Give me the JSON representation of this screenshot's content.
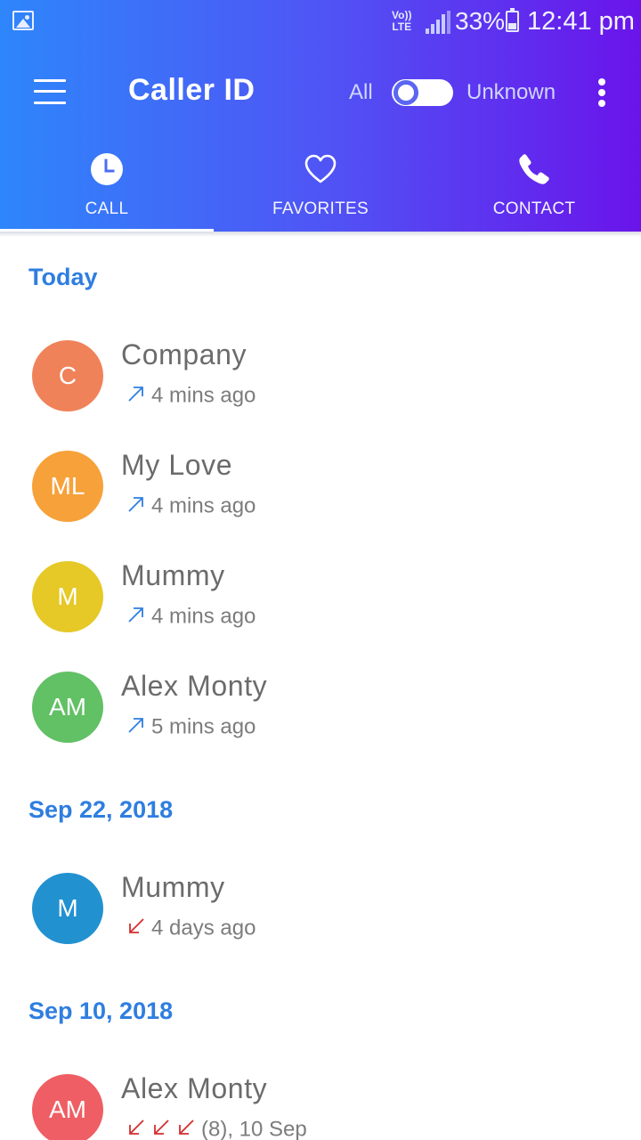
{
  "status_bar": {
    "volte_top": "Vo))",
    "volte_bottom": "LTE",
    "battery": "33%",
    "time": "12:41 pm",
    "icons": [
      "gallery-icon",
      "signal-icon",
      "battery-icon"
    ]
  },
  "app_bar": {
    "title": "Caller ID",
    "toggle_left": "All",
    "toggle_right": "Unknown",
    "gradient": [
      "#2e86fb",
      "#6a14ea"
    ]
  },
  "tabs": [
    {
      "label": "CALL",
      "icon": "clock-icon",
      "selected": true
    },
    {
      "label": "FAVORITES",
      "icon": "heart-icon",
      "selected": false
    },
    {
      "label": "CONTACT",
      "icon": "phone-icon",
      "selected": false
    }
  ],
  "sections": [
    {
      "title": "Today",
      "calls": [
        {
          "initials": "C",
          "name": "Company",
          "time": "4 mins ago",
          "direction": "outgoing",
          "color": "#f0825a"
        },
        {
          "initials": "ML",
          "name": "My Love",
          "time": "4 mins ago",
          "direction": "outgoing",
          "color": "#f7a13a"
        },
        {
          "initials": "M",
          "name": "Mummy",
          "time": "4 mins ago",
          "direction": "outgoing",
          "color": "#e6c826"
        },
        {
          "initials": "AM",
          "name": "Alex Monty",
          "time": "5 mins ago",
          "direction": "outgoing",
          "color": "#62c065"
        }
      ]
    },
    {
      "title": "Sep 22, 2018",
      "calls": [
        {
          "initials": "M",
          "name": "Mummy",
          "time": "4 days ago",
          "direction": "missed",
          "color": "#2291d0"
        }
      ]
    },
    {
      "title": "Sep 10, 2018",
      "calls": [
        {
          "initials": "AM",
          "name": "Alex Monty",
          "time": "(8), 10 Sep",
          "direction": "missed",
          "color": "#ee5e64"
        }
      ]
    }
  ],
  "colors": {
    "section_title": "#2f7ee0",
    "outgoing_arrow": "#2f7ee0",
    "missed_arrow": "#d32f2f"
  }
}
